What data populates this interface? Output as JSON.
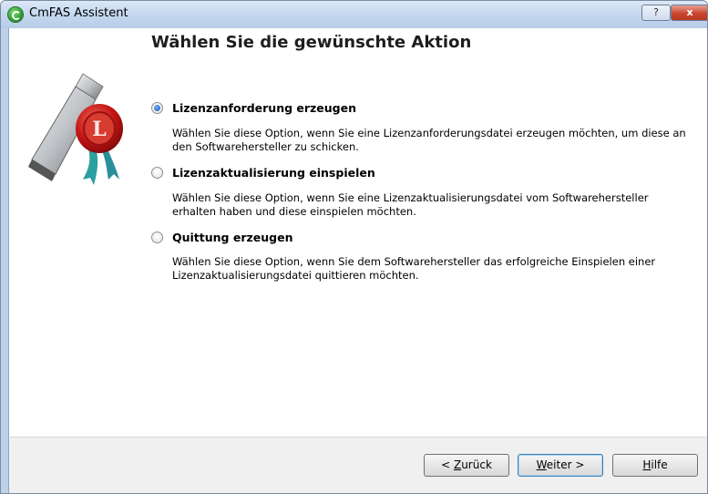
{
  "window": {
    "title": "CmFAS Assistent",
    "help_glyph": "?",
    "close_glyph": "x"
  },
  "heading": "Wählen Sie die gewünschte Aktion",
  "options": [
    {
      "label": "Lizenzanforderung erzeugen",
      "desc": "Wählen Sie diese Option, wenn Sie eine Lizenzanforderungsdatei erzeugen möchten, um diese an den Softwarehersteller zu schicken.",
      "checked": true
    },
    {
      "label": "Lizenzaktualisierung einspielen",
      "desc": "Wählen Sie diese Option, wenn Sie eine Lizenzaktualisierungsdatei vom Softwarehersteller erhalten haben und diese einspielen möchten.",
      "checked": false
    },
    {
      "label": "Quittung erzeugen",
      "desc": "Wählen Sie diese Option, wenn Sie dem Softwarehersteller das erfolgreiche Einspielen einer Lizenzaktualisierungsdatei quittieren möchten.",
      "checked": false
    }
  ],
  "buttons": {
    "back": {
      "prefix": "< ",
      "key": "Z",
      "rest": "urück"
    },
    "next": {
      "prefix": "",
      "key": "W",
      "rest": "eiter >"
    },
    "help": {
      "prefix": "",
      "key": "H",
      "rest": "ilfe"
    }
  },
  "icons": {
    "app": "codemeter-icon",
    "wizard": "license-dongle-seal-icon"
  }
}
